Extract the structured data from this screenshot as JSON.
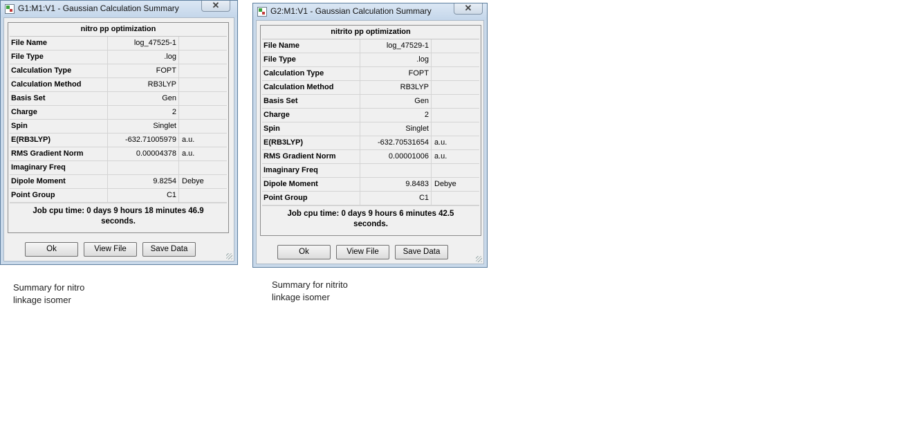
{
  "windows": [
    {
      "title": "G1:M1:V1 - Gaussian Calculation Summary",
      "close_symbol": "✕",
      "header": "nitro pp optimization",
      "rows": [
        {
          "label": "File Name",
          "value": "log_47525-1",
          "unit": ""
        },
        {
          "label": "File Type",
          "value": ".log",
          "unit": ""
        },
        {
          "label": "Calculation Type",
          "value": "FOPT",
          "unit": ""
        },
        {
          "label": "Calculation Method",
          "value": "RB3LYP",
          "unit": ""
        },
        {
          "label": "Basis Set",
          "value": "Gen",
          "unit": ""
        },
        {
          "label": "Charge",
          "value": "2",
          "unit": ""
        },
        {
          "label": "Spin",
          "value": "Singlet",
          "unit": ""
        },
        {
          "label": "E(RB3LYP)",
          "value": "-632.71005979",
          "unit": "a.u."
        },
        {
          "label": "RMS Gradient Norm",
          "value": "0.00004378",
          "unit": "a.u."
        },
        {
          "label": "Imaginary Freq",
          "value": "",
          "unit": ""
        },
        {
          "label": "Dipole Moment",
          "value": "9.8254",
          "unit": "Debye"
        },
        {
          "label": "Point Group",
          "value": "C1",
          "unit": ""
        }
      ],
      "cpu_line1": "Job cpu time:  0 days  9 hours 18 minutes 46.9",
      "cpu_line2": "seconds.",
      "buttons": {
        "ok": "Ok",
        "view": "View File",
        "save": "Save Data"
      },
      "caption": "Summary for nitro linkage isomer"
    },
    {
      "title": "G2:M1:V1 - Gaussian Calculation Summary",
      "close_symbol": "✕",
      "header": "nitrito pp optimization",
      "rows": [
        {
          "label": "File Name",
          "value": "log_47529-1",
          "unit": ""
        },
        {
          "label": "File Type",
          "value": ".log",
          "unit": ""
        },
        {
          "label": "Calculation Type",
          "value": "FOPT",
          "unit": ""
        },
        {
          "label": "Calculation Method",
          "value": "RB3LYP",
          "unit": ""
        },
        {
          "label": "Basis Set",
          "value": "Gen",
          "unit": ""
        },
        {
          "label": "Charge",
          "value": "2",
          "unit": ""
        },
        {
          "label": "Spin",
          "value": "Singlet",
          "unit": ""
        },
        {
          "label": "E(RB3LYP)",
          "value": "-632.70531654",
          "unit": "a.u."
        },
        {
          "label": "RMS Gradient Norm",
          "value": "0.00001006",
          "unit": "a.u."
        },
        {
          "label": "Imaginary Freq",
          "value": "",
          "unit": ""
        },
        {
          "label": "Dipole Moment",
          "value": "9.8483",
          "unit": "Debye"
        },
        {
          "label": "Point Group",
          "value": "C1",
          "unit": ""
        }
      ],
      "cpu_line1": "Job cpu time:  0 days  9 hours  6 minutes 42.5",
      "cpu_line2": "seconds.",
      "buttons": {
        "ok": "Ok",
        "view": "View File",
        "save": "Save Data"
      },
      "caption": "Summary for nitrito linkage isomer"
    }
  ]
}
